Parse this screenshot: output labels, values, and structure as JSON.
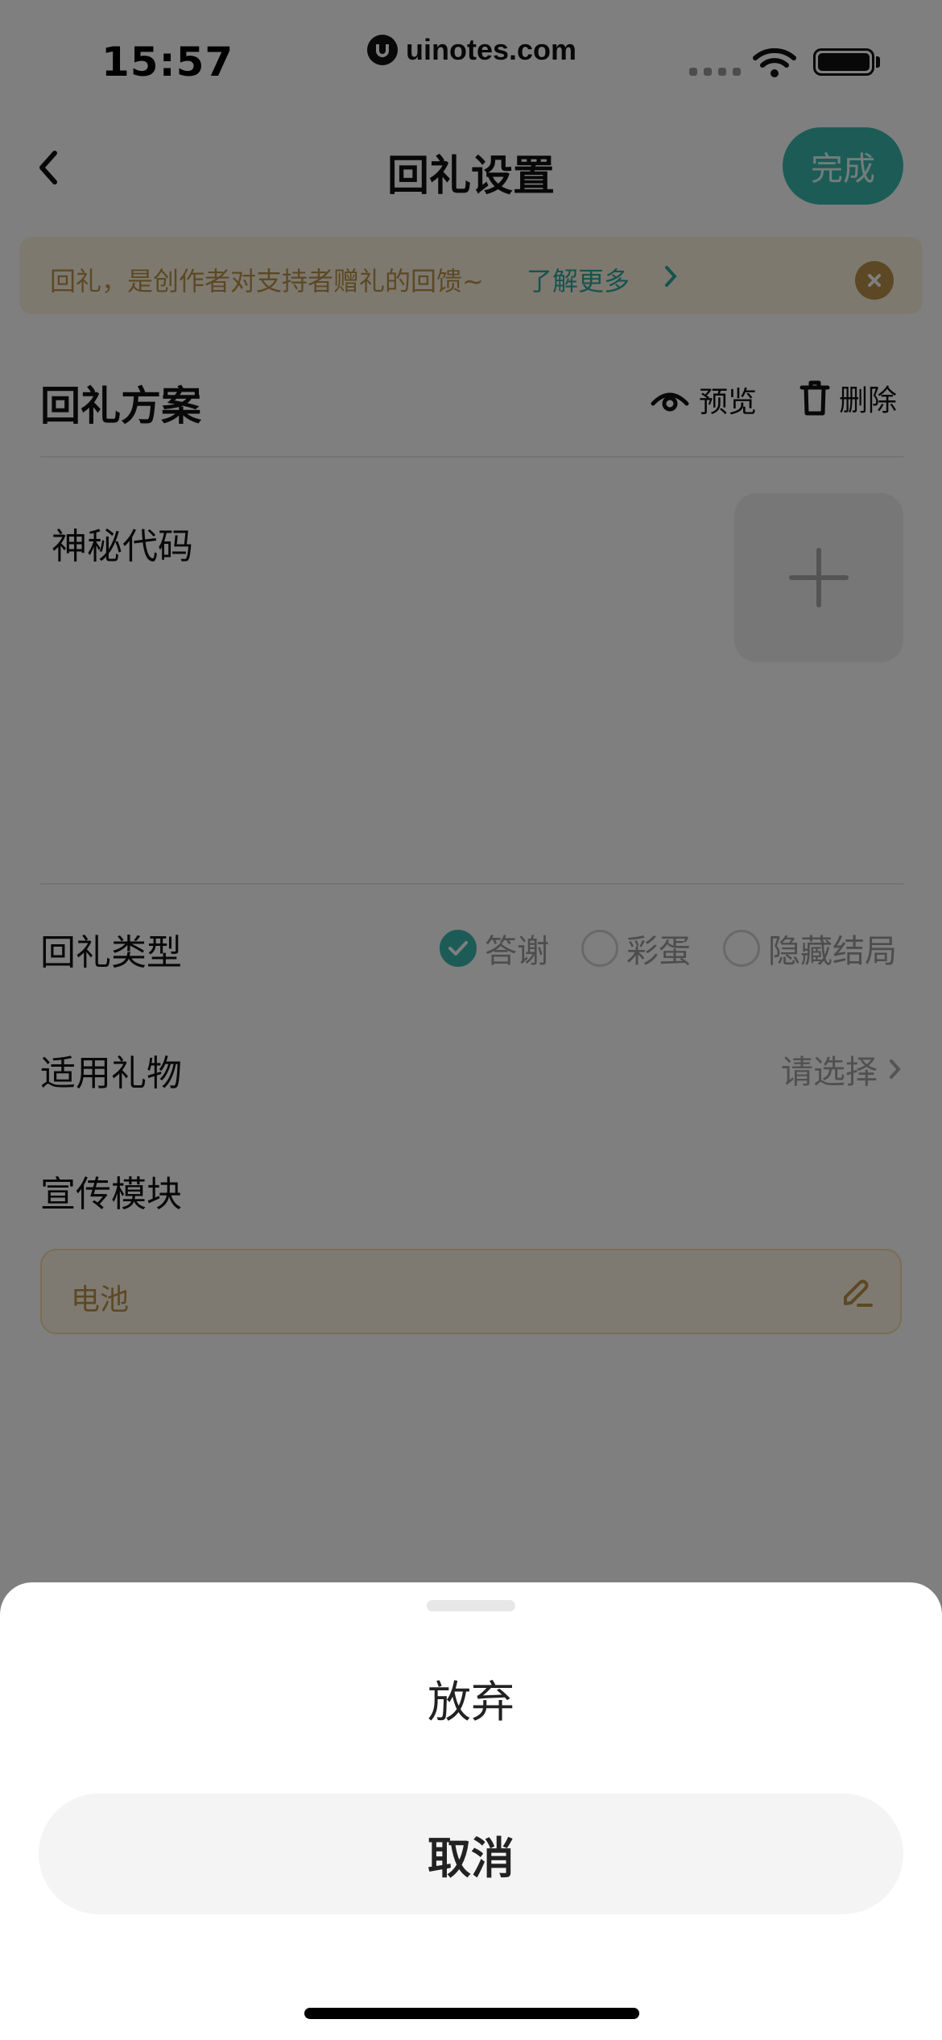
{
  "status_bar": {
    "time": "15:57",
    "watermark": "uinotes.com"
  },
  "nav": {
    "title": "回礼设置",
    "done_label": "完成"
  },
  "notice": {
    "text": "回礼，是创作者对支持者赠礼的回馈~",
    "link": "了解更多"
  },
  "plan": {
    "section_title": "回礼方案",
    "preview_label": "预览",
    "delete_label": "删除",
    "name": "神秘代码"
  },
  "gift_type": {
    "label": "回礼类型",
    "options": [
      {
        "label": "答谢",
        "checked": true
      },
      {
        "label": "彩蛋",
        "checked": false
      },
      {
        "label": "隐藏结局",
        "checked": false
      }
    ]
  },
  "applicable_gift": {
    "label": "适用礼物",
    "placeholder": "请选择"
  },
  "promo": {
    "label": "宣传模块",
    "value": "电池"
  },
  "sheet": {
    "abandon_label": "放弃",
    "cancel_label": "取消"
  },
  "colors": {
    "accent": "#3bb9ad",
    "notice_bg": "#fdf3de",
    "notice_text": "#b89148"
  }
}
